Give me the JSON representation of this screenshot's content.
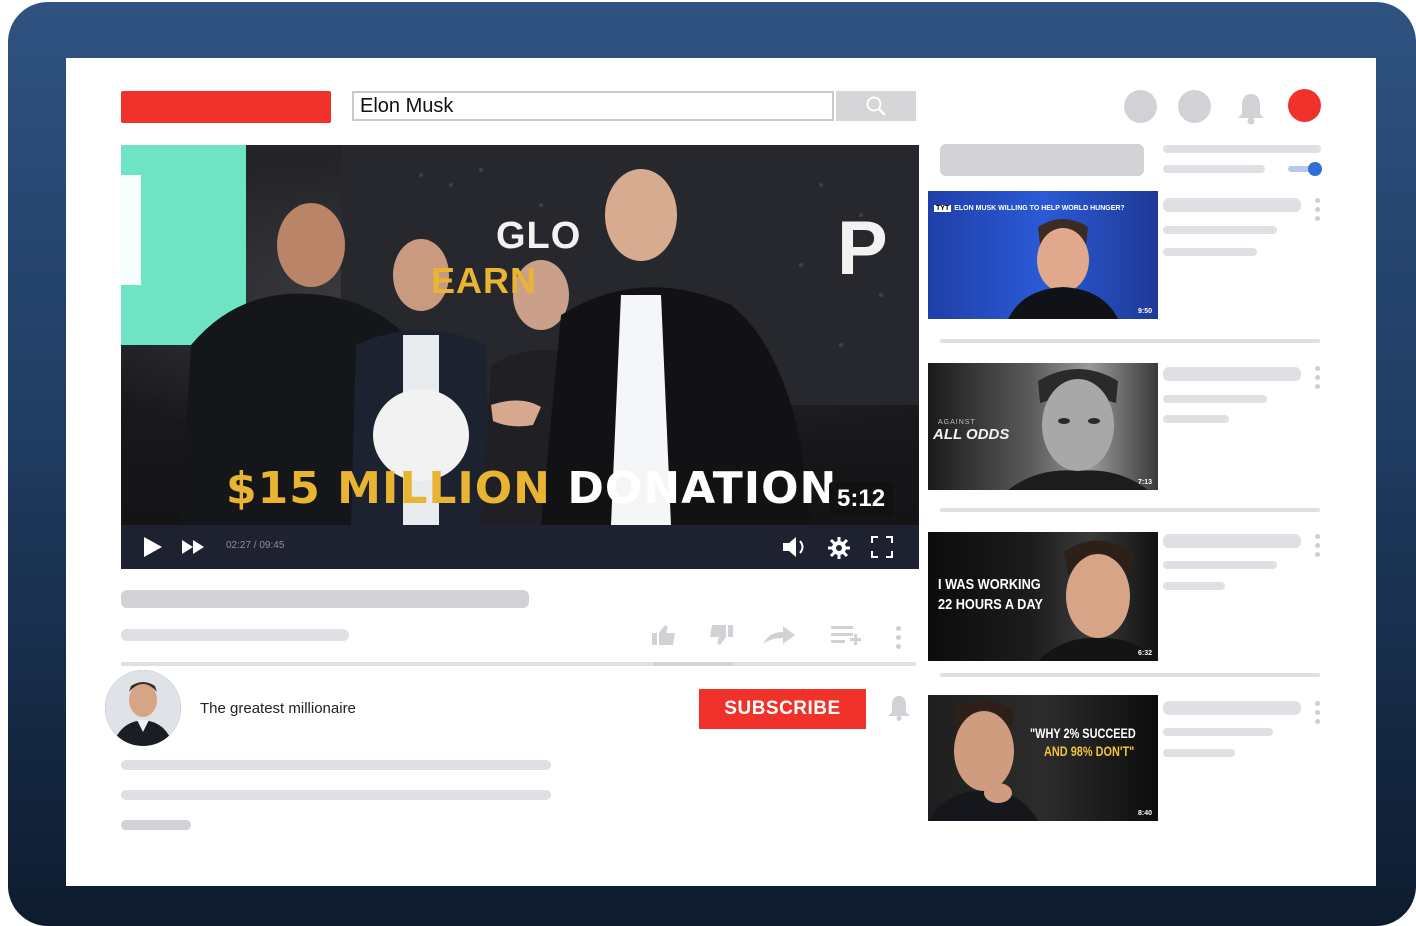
{
  "search": {
    "value": "Elon Musk",
    "icon": "search-icon"
  },
  "colors": {
    "brand": "#f0322a",
    "frame": "#203d63",
    "accent_blue": "#2f6fd8",
    "caption_gold": "#e8b431"
  },
  "player": {
    "caption_gold": "$15 MILLION",
    "caption_white": "DONATION",
    "bg_text_1": "GLO",
    "bg_text_2": "EARN",
    "bg_text_3": "P",
    "duration": "5:12",
    "timecode": "02:27 / 09:45"
  },
  "channel": {
    "name": "The greatest millionaire",
    "subscribe_label": "SUBSCRIBE"
  },
  "sidebar": {
    "videos": [
      {
        "overlay": "ELON MUSK WILLING TO HELP WORLD HUNGER?",
        "brand": "TYT",
        "duration": "9:50"
      },
      {
        "overlay_small": "AGAINST",
        "overlay": "ALL ODDS",
        "duration": "7:13"
      },
      {
        "overlay": "I WAS WORKING",
        "overlay2": "22 HOURS A DAY",
        "duration": "6:32"
      },
      {
        "overlay": "\"WHY 2% SUCCEED",
        "overlay2": "AND 98% DON'T\"",
        "duration": "8:40"
      }
    ]
  }
}
